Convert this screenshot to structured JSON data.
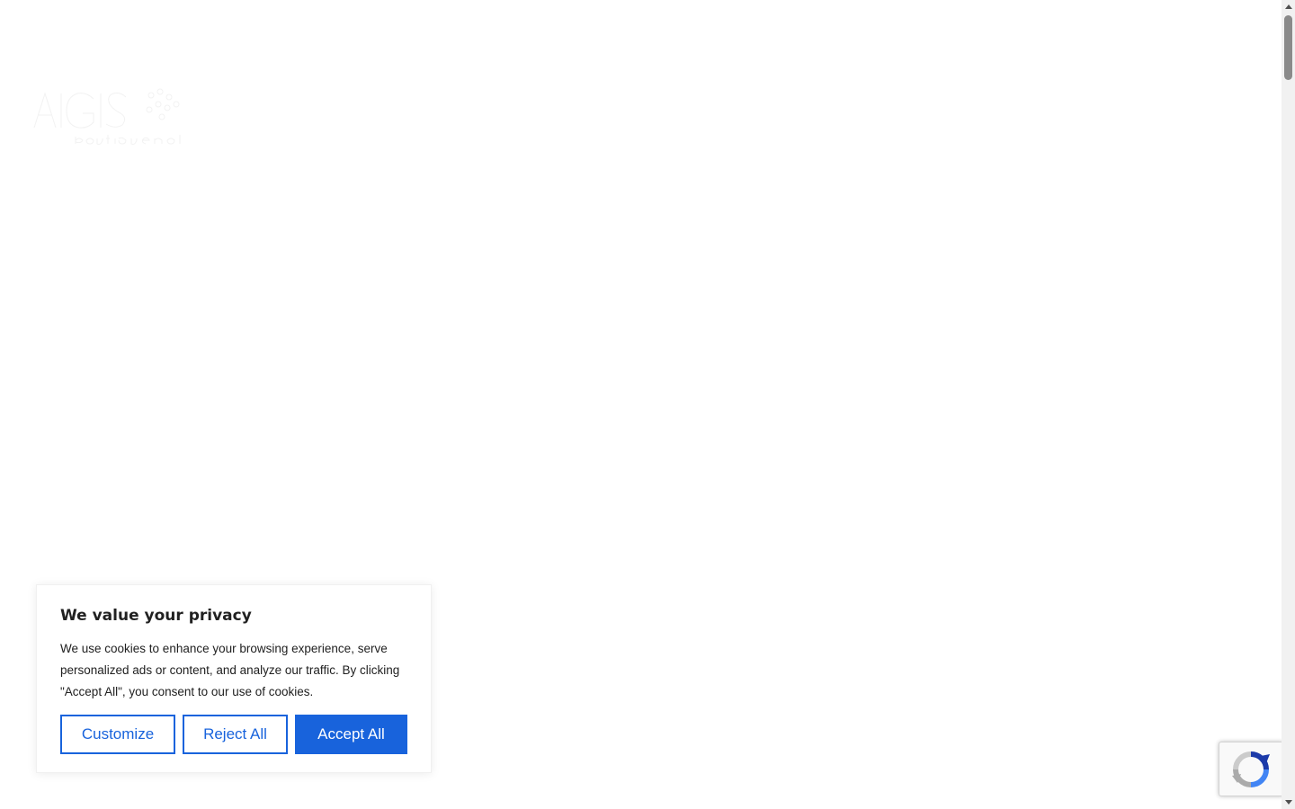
{
  "logo": {
    "icon": "aigis-logo-icon",
    "color": "#ffffff"
  },
  "cookie_banner": {
    "title": "We value your privacy",
    "body": "We use cookies to enhance your browsing experience, serve personalized ads or content, and analyze our traffic. By clicking \"Accept All\", you consent to our use of cookies.",
    "buttons": {
      "customize": "Customize",
      "reject": "Reject All",
      "accept": "Accept All"
    },
    "accent_color": "#1863dc"
  },
  "recaptcha": {
    "icon": "recaptcha-icon"
  },
  "scrollbar": {
    "icons": [
      "chevron-up-icon",
      "chevron-down-icon"
    ]
  }
}
